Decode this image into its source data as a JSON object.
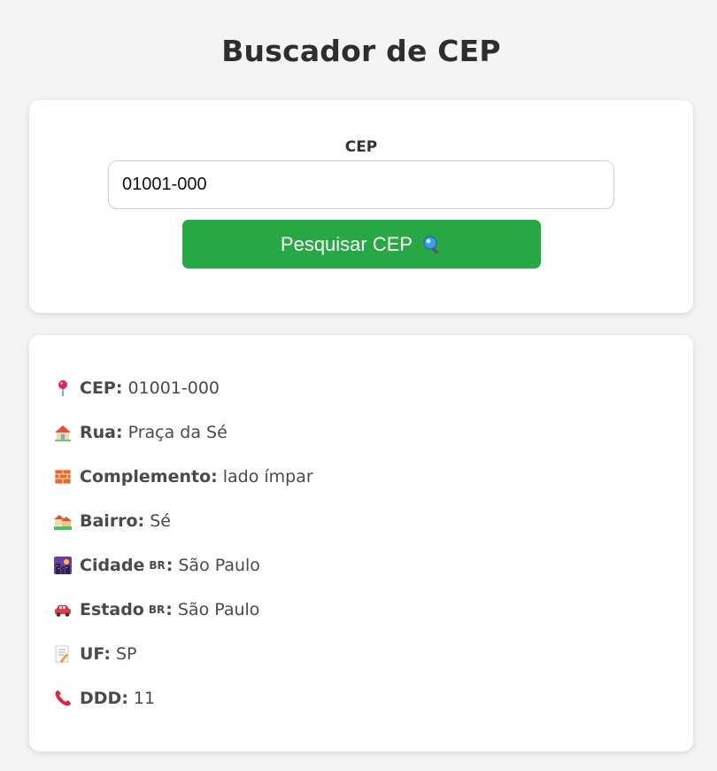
{
  "header": {
    "title": "Buscador de CEP"
  },
  "search": {
    "label": "CEP",
    "input_value": "01001-000",
    "button_label": "Pesquisar CEP",
    "button_color": "#28a745"
  },
  "results": {
    "cep": {
      "icon": "pin-icon",
      "label": "CEP:",
      "value": "01001-000"
    },
    "rua": {
      "icon": "house-icon",
      "label": "Rua:",
      "value": "Praça da Sé"
    },
    "complemento": {
      "icon": "brick-icon",
      "label": "Complemento:",
      "value": "lado ímpar"
    },
    "bairro": {
      "icon": "houses-icon",
      "label": "Bairro:",
      "value": "Sé"
    },
    "cidade": {
      "icon": "city-icon",
      "label": "Cidade",
      "flag": "BR",
      "value": "São Paulo"
    },
    "estado": {
      "icon": "car-icon",
      "label": "Estado",
      "flag": "BR",
      "value": "São Paulo"
    },
    "uf": {
      "icon": "memo-icon",
      "label": "UF:",
      "value": "SP"
    },
    "ddd": {
      "icon": "phone-icon",
      "label": "DDD:",
      "value": "11"
    }
  }
}
